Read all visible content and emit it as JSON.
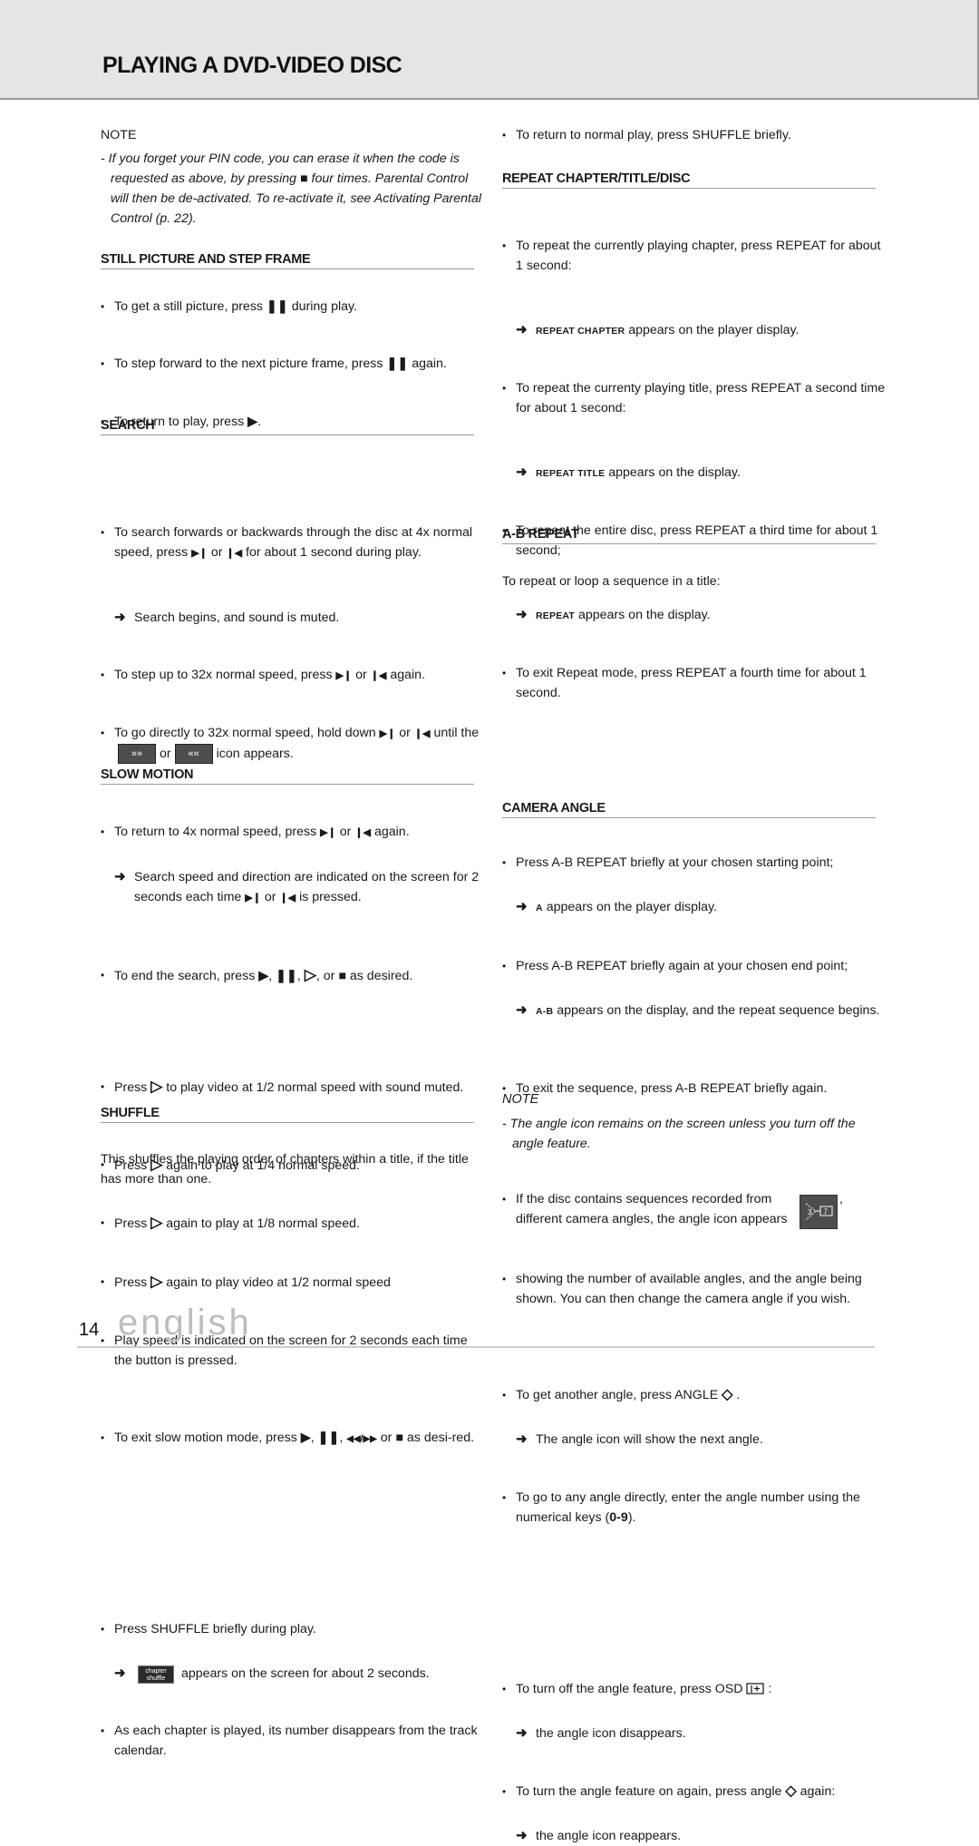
{
  "header": {
    "title": "PLAYING A DVD-VIDEO DISC"
  },
  "left": {
    "note": {
      "label": "NOTE",
      "text_a": "- If you forget your PIN code, you can erase it when the code is requested as above, by pressing",
      "icon": "stop-icon",
      "text_b": "four times. Parental Control will then be de-activated. To re-activate it, see Activating Parental Control (p. 22)."
    },
    "still": {
      "heading": "STILL PICTURE AND STEP FRAME",
      "b1a": "To get a still picture, press",
      "b1b": "during play.",
      "b2a": "To step forward to the next picture frame, press",
      "b2b": "again.",
      "b3a": "To return to play, press",
      "b3b": "."
    },
    "search": {
      "heading": "SEARCH",
      "b1a": "To search forwards or backwards through the disc at 4x normal speed, press",
      "b1or": "or",
      "b1b": "for about 1 second during play.",
      "a1": "Search begins, and sound is muted.",
      "b2a": "To step up to 32x normal speed, press",
      "b2or": "or",
      "b2b": "again.",
      "b3a": "To go directly to 32x normal speed, hold down",
      "b3or": "or",
      "b3b": "until the",
      "b3or2": "or",
      "b3c": "icon appears.",
      "b4a": "To return to 4x normal speed, press",
      "b4or": "or",
      "b4b": "again.",
      "a4a": "Search speed and direction are indicated on the screen for 2 seconds each time",
      "a4or": "or",
      "a4b": "is pressed.",
      "b5a": "To end the search, press",
      "b5b": ", or",
      "b5c": "as desired."
    },
    "slow": {
      "heading": "SLOW MOTION",
      "press": "Press",
      "b1": "to play video at 1/2 normal speed with sound muted.",
      "b2": "again to play at 1/4 normal speed.",
      "b3": "again to play at 1/8 normal speed.",
      "b4": "again to play video at 1/2 normal speed",
      "b5": "Play speed is indicated on the screen for 2 seconds each time the button is pressed.",
      "b6a": "To exit slow motion mode, press",
      "b6b": "or",
      "b6c": "as desi-red."
    },
    "shuffle": {
      "heading": "SHUFFLE",
      "intro": "This shuffles the playing order of chapters within a title, if the title has more than one.",
      "b1": "Press SHUFFLE briefly during play.",
      "badge_line1": "chapter",
      "badge_line2": "shuffle",
      "a1": "appears on the screen for about 2 seconds.",
      "b2": "As each chapter is played, its number disappears from the track calendar."
    }
  },
  "right": {
    "shuffle_return": "To return to normal play, press SHUFFLE briefly.",
    "repeat": {
      "heading": "REPEAT CHAPTER/TITLE/DISC",
      "b1": "To repeat the currently playing chapter, press REPEAT for about 1 second:",
      "a1sc": "REPEAT CHAPTER",
      "a1": "appears on the player display.",
      "b2": "To repeat the currenty playing title, press REPEAT a second time for about 1 second:",
      "a2sc": "REPEAT TITLE",
      "a2": "appears on the display.",
      "b3": "To repeat the entire disc, press REPEAT a third time for about 1 second;",
      "a3sc": "REPEAT",
      "a3": "appears on the display.",
      "b4": "To exit Repeat mode, press REPEAT a fourth time for about 1 second."
    },
    "ab": {
      "heading": "A-B REPEAT",
      "intro": "To repeat or loop a sequence in a title:",
      "b1": "Press A-B REPEAT briefly at your chosen starting point;",
      "a1sc": "A",
      "a1": "appears on the player display.",
      "b2": "Press A-B REPEAT briefly again at your chosen end point;",
      "a2sc": "A-B",
      "a2": "appears on the display, and the repeat sequence begins.",
      "b3": "To exit the sequence, press A-B REPEAT briefly again."
    },
    "camera": {
      "heading": "CAMERA ANGLE",
      "b1a": "If the disc contains sequences recorded from different camera angles, the angle  icon appears",
      "b1b": "showing the number of available angles, and the angle being shown. You can then change the camera angle if you wish.",
      "angle_icon_total": "3",
      "angle_icon_current": "7",
      "b2a": "To get another angle, press ANGLE",
      "b2b": ".",
      "a2": "The angle icon will show the next angle.",
      "b3a": "To go to any angle directly, enter the angle number using the numerical keys (",
      "b3keys": "0-9",
      "b3b": ")."
    },
    "note": {
      "label": "NOTE",
      "text": "- The angle icon remains on the screen unless you turn off the angle feature."
    },
    "osd": {
      "b1a": "To turn off the angle feature, press OSD",
      "b1b": ":",
      "a1": "the angle icon disappears.",
      "b2a": "To turn the angle feature on again, press angle",
      "b2b": "again:",
      "a2": "the angle icon reappears."
    }
  },
  "footer": {
    "page_number": "14",
    "language": "english"
  },
  "colors": {
    "header_bg": "#e5e5e5",
    "rule": "#9a9a9a",
    "footer_word": "#bdbdbd",
    "icon_box": "#4d4d4d"
  }
}
